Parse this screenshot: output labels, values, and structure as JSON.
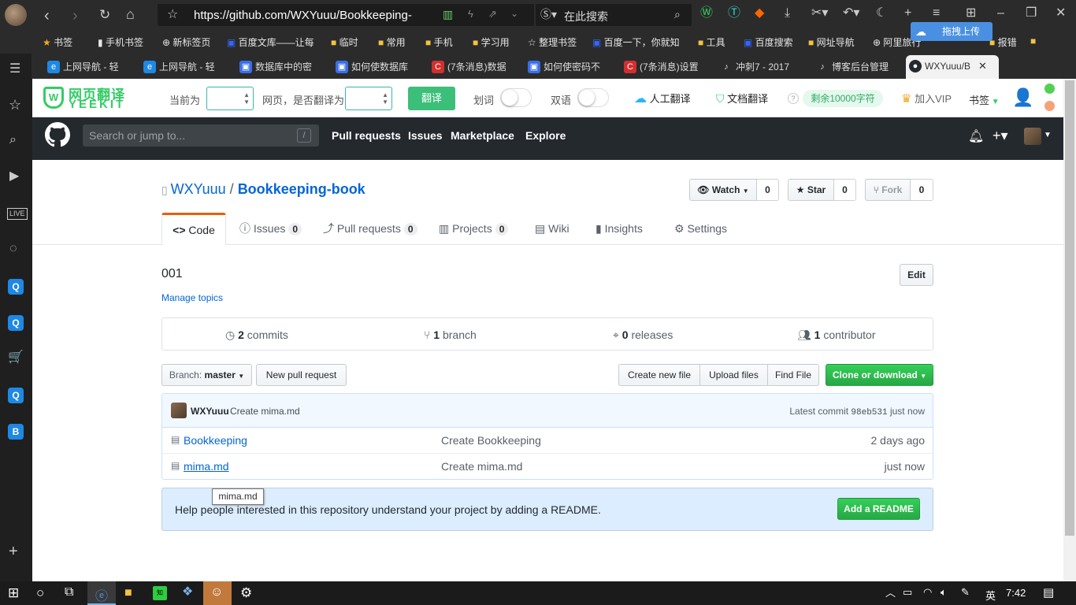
{
  "browser": {
    "url": "https://github.com/WXYuuu/Bookkeeping-",
    "search_placeholder": "在此搜索",
    "bookmarks": [
      "书签",
      "手机书签",
      "新标签页",
      "百度文库——让每",
      "临时",
      "常用",
      "手机",
      "学习用",
      "整理书签",
      "百度一下，你就知",
      "工具",
      "百度搜索",
      "网址导航",
      "阿里旅行",
      "报错"
    ],
    "upload_badge": "拖拽上传",
    "tabs": [
      "上网导航 - 轻",
      "上网导航 - 轻",
      "数据库中的密",
      "如何使数据库",
      "(7条消息)数据",
      "如何使密码不",
      "(7条消息)设置",
      "冲刺7 - 2017",
      "博客后台管理",
      "WXYuuu/B"
    ]
  },
  "yeekit": {
    "logo_cn": "网页翻译",
    "logo_en": "YEEKIT",
    "current_label": "当前为",
    "translate_q": "网页，是否翻译为",
    "translate_btn": "翻译",
    "huaci": "划词",
    "shuangyu": "双语",
    "human_translate": "人工翻译",
    "doc_translate": "文档翻译",
    "remaining": "剩余10000字符",
    "join_vip": "加入VIP",
    "shuqian": "书签"
  },
  "github": {
    "search_placeholder": "Search or jump to...",
    "slash_key": "/",
    "nav": [
      "Pull requests",
      "Issues",
      "Marketplace",
      "Explore"
    ],
    "owner": "WXYuuu",
    "separator": "/",
    "repo": "Bookkeeping-book",
    "watch_label": "Watch",
    "watch_count": "0",
    "star_label": "Star",
    "star_count": "0",
    "fork_label": "Fork",
    "fork_count": "0",
    "tabs": {
      "code": "Code",
      "issues": "Issues",
      "issues_count": "0",
      "pulls": "Pull requests",
      "pulls_count": "0",
      "projects": "Projects",
      "projects_count": "0",
      "wiki": "Wiki",
      "insights": "Insights",
      "settings": "Settings"
    },
    "description": "001",
    "edit_label": "Edit",
    "manage_topics": "Manage topics",
    "summary": {
      "commits_n": "2",
      "commits_label": "commits",
      "branch_n": "1",
      "branch_label": "branch",
      "releases_n": "0",
      "releases_label": "releases",
      "contributors_n": "1",
      "contributors_label": "contributor"
    },
    "branch_label": "Branch:",
    "branch_name": "master",
    "new_pr": "New pull request",
    "create_file": "Create new file",
    "upload_files": "Upload files",
    "find_file": "Find File",
    "clone": "Clone or download",
    "commit": {
      "author": "WXYuuu",
      "message": "Create mima.md",
      "latest_label": "Latest commit",
      "sha": "98eb531",
      "time": "just now"
    },
    "files": [
      {
        "name": "Bookkeeping",
        "message": "Create Bookkeeping",
        "age": "2 days ago"
      },
      {
        "name": "mima.md",
        "message": "Create mima.md",
        "age": "just now"
      }
    ],
    "tooltip": "mima.md",
    "readme_text": "Help people interested in this repository understand your project by adding a README.",
    "add_readme": "Add a README"
  },
  "taskbar": {
    "time": "7:42",
    "ime": "英"
  }
}
